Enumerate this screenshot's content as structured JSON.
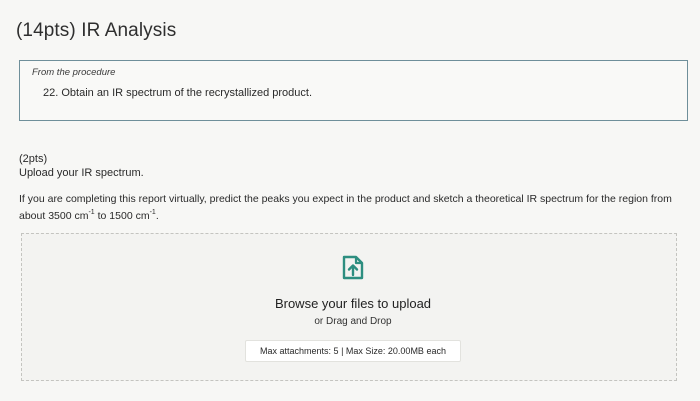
{
  "section": {
    "title": "(14pts) IR Analysis"
  },
  "procedure": {
    "label": "From the procedure",
    "text": "22. Obtain an IR spectrum of the recrystallized product."
  },
  "question": {
    "points": "(2pts)",
    "upload_label": "Upload your IR spectrum.",
    "instructions_part1": "If you are completing this report virtually, predict the peaks you expect in the product and sketch a theoretical IR spectrum for the region from about 3500 cm",
    "sup1": "-1",
    "instructions_part2": " to 1500 cm",
    "sup2": "-1",
    "instructions_part3": "."
  },
  "upload": {
    "icon": "upload-file-icon",
    "browse_text": "Browse your files to upload",
    "drag_text": "or Drag and Drop",
    "max_text": "Max attachments: 5 | Max Size: 20.00MB each"
  },
  "colors": {
    "icon_teal": "#2d8e80",
    "box_border": "#6f8f9a"
  }
}
